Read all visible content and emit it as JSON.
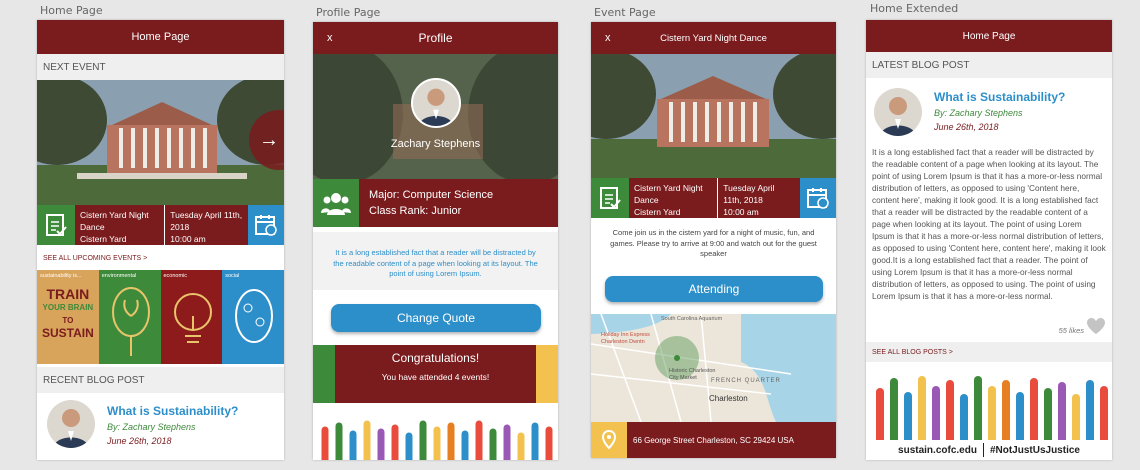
{
  "labels": {
    "home": "Home Page",
    "profile": "Profile Page",
    "event": "Event Page",
    "home_ext": "Home Extended"
  },
  "home": {
    "title": "Home Page",
    "next_event_header": "NEXT EVENT",
    "event_name": "Cistern Yard Night Dance",
    "event_location": "Cistern Yard",
    "event_date": "Tuesday April 11th, 2018",
    "event_time": "10:00 am",
    "see_all_events": "SEE ALL UPCOMING EVENTS >",
    "tiles": [
      {
        "label": "sustainability is...",
        "color": "#d8a35a"
      },
      {
        "label": "environmental",
        "color": "#3e8a3b"
      },
      {
        "label": "economic",
        "color": "#8e1b1b"
      },
      {
        "label": "social",
        "color": "#2d8fc9"
      }
    ],
    "tile_poster_lines": [
      "TRAIN",
      "YOUR BRAIN",
      "TO",
      "SUSTAIN"
    ],
    "recent_blog_header": "RECENT BLOG POST",
    "blog_title": "What is Sustainability?",
    "blog_author": "By: Zachary Stephens",
    "blog_date": "June 26th, 2018"
  },
  "profile": {
    "close": "x",
    "title": "Profile",
    "name": "Zachary Stephens",
    "major": "Major: Computer Science",
    "class_rank": "Class Rank: Junior",
    "quote": "It is a long established fact that a reader will be distracted by the readable content of a page when looking at its layout. The point of using Lorem Ipsum.",
    "change_quote": "Change Quote",
    "congrats_title": "Congratulations!",
    "congrats_text": "You have attended 4 events!"
  },
  "event": {
    "close": "x",
    "title": "Cistern Yard Night Dance",
    "event_name": "Cistern Yard Night Dance",
    "event_location": "Cistern Yard",
    "event_date": "Tuesday April 11th, 2018",
    "event_time": "10:00 am",
    "description": "Come join us in the cistern yard for a night of music, fun, and games. Please try to arrive at 9:00 and watch out for the guest speaker",
    "attending": "Attending",
    "map_labels": [
      "South Carolina Aquarium",
      "Holiday Inn Express Charleston Dwntn",
      "Historic Charleston City Market",
      "FRENCH QUARTER",
      "Charleston"
    ],
    "address": "66 George Street Charleston, SC 29424 USA"
  },
  "home_ext": {
    "title": "Home Page",
    "latest_blog_header": "LATEST BLOG POST",
    "blog_title": "What is Sustainability?",
    "blog_author": "By: Zachary Stephens",
    "blog_date": "June 26th, 2018",
    "blog_body": "It is a long established fact that a reader will be distracted by the readable content of a page when looking at its layout. The point of using Lorem Ipsum is that it has a more-or-less normal distribution of letters, as opposed to using 'Content here, content here', making it look good. It is a long established fact that a reader will be distracted by the readable content of a page when looking at its layout. The point of using Lorem Ipsum is that it has a more-or-less normal distribution of letters, as opposed to using 'Content here, content here', making it look good.It is a long established fact that a reader. The point of using Lorem Ipsum is that it has a more-or-less normal distribution of letters, as opposed to using. The point of using Lorem Ipsum is that it has a more-or-less normal.",
    "likes": "55 likes",
    "see_all_blog": "SEE ALL BLOG POSTS >",
    "footer_site": "sustain.cofc.edu",
    "footer_tag": "#NotJustUsJustice"
  },
  "colors": {
    "brand": "#7a1b1d",
    "green": "#3e8a3b",
    "blue": "#2d8fc9",
    "yellow": "#f2c14e"
  }
}
